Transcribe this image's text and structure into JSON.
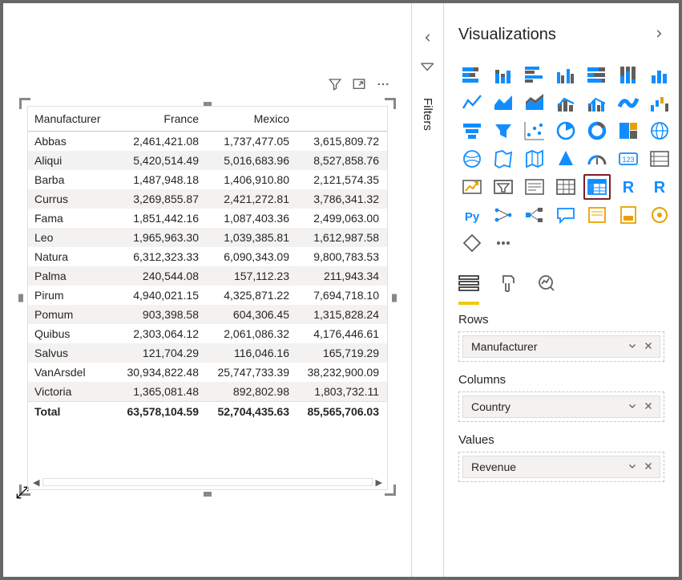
{
  "canvas": {
    "matrix": {
      "row_header": "Manufacturer",
      "columns": [
        "France",
        "Mexico"
      ],
      "rows": [
        {
          "label": "Abbas",
          "values": [
            "2,461,421.08",
            "1,737,477.05",
            "3,615,809.72"
          ]
        },
        {
          "label": "Aliqui",
          "values": [
            "5,420,514.49",
            "5,016,683.96",
            "8,527,858.76"
          ]
        },
        {
          "label": "Barba",
          "values": [
            "1,487,948.18",
            "1,406,910.80",
            "2,121,574.35"
          ]
        },
        {
          "label": "Currus",
          "values": [
            "3,269,855.87",
            "2,421,272.81",
            "3,786,341.32"
          ]
        },
        {
          "label": "Fama",
          "values": [
            "1,851,442.16",
            "1,087,403.36",
            "2,499,063.00"
          ]
        },
        {
          "label": "Leo",
          "values": [
            "1,965,963.30",
            "1,039,385.81",
            "1,612,987.58"
          ]
        },
        {
          "label": "Natura",
          "values": [
            "6,312,323.33",
            "6,090,343.09",
            "9,800,783.53"
          ]
        },
        {
          "label": "Palma",
          "values": [
            "240,544.08",
            "157,112.23",
            "211,943.34"
          ]
        },
        {
          "label": "Pirum",
          "values": [
            "4,940,021.15",
            "4,325,871.22",
            "7,694,718.10"
          ]
        },
        {
          "label": "Pomum",
          "values": [
            "903,398.58",
            "604,306.45",
            "1,315,828.24"
          ]
        },
        {
          "label": "Quibus",
          "values": [
            "2,303,064.12",
            "2,061,086.32",
            "4,176,446.61"
          ]
        },
        {
          "label": "Salvus",
          "values": [
            "121,704.29",
            "116,046.16",
            "165,719.29"
          ]
        },
        {
          "label": "VanArsdel",
          "values": [
            "30,934,822.48",
            "25,747,733.39",
            "38,232,900.09"
          ]
        },
        {
          "label": "Victoria",
          "values": [
            "1,365,081.48",
            "892,802.98",
            "1,803,732.11"
          ]
        }
      ],
      "total_label": "Total",
      "totals": [
        "63,578,104.59",
        "52,704,435.63",
        "85,565,706.03"
      ]
    }
  },
  "filters_pane": {
    "label": "Filters"
  },
  "viz_pane": {
    "title": "Visualizations",
    "wells": {
      "rows": {
        "label": "Rows",
        "chip": "Manufacturer"
      },
      "cols": {
        "label": "Columns",
        "chip": "Country"
      },
      "vals": {
        "label": "Values",
        "chip": "Revenue"
      }
    }
  },
  "colors": {
    "accent": "#118dff",
    "yellow": "#f2c811",
    "selected_border": "#7d1b29"
  }
}
